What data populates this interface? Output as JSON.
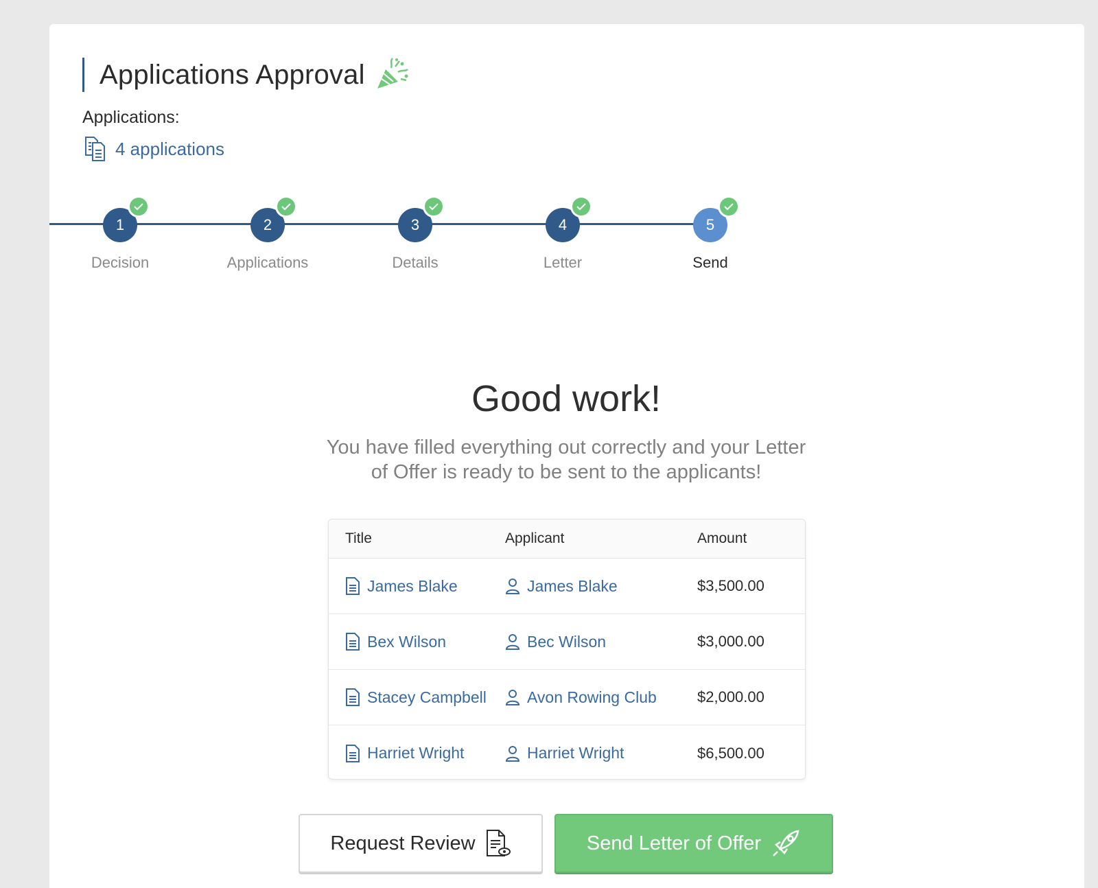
{
  "header": {
    "title": "Applications Approval",
    "icon": "party-popper-icon"
  },
  "applications": {
    "label": "Applications:",
    "link_text": "4 applications"
  },
  "stepper": {
    "steps": [
      {
        "number": "1",
        "label": "Decision",
        "completed": true,
        "active": false
      },
      {
        "number": "2",
        "label": "Applications",
        "completed": true,
        "active": false
      },
      {
        "number": "3",
        "label": "Details",
        "completed": true,
        "active": false
      },
      {
        "number": "4",
        "label": "Letter",
        "completed": true,
        "active": false
      },
      {
        "number": "5",
        "label": "Send",
        "completed": true,
        "active": true
      }
    ]
  },
  "summary": {
    "headline": "Good work!",
    "message": "You have filled everything out correctly and your Letter of Offer is ready to be sent to the applicants!"
  },
  "table": {
    "columns": [
      "Title",
      "Applicant",
      "Amount"
    ],
    "rows": [
      {
        "title": "James Blake",
        "applicant": "James Blake",
        "amount": "$3,500.00"
      },
      {
        "title": "Bex Wilson",
        "applicant": "Bec Wilson",
        "amount": "$3,000.00"
      },
      {
        "title": "Stacey Campbell",
        "applicant": "Avon Rowing Club",
        "amount": "$2,000.00"
      },
      {
        "title": "Harriet Wright",
        "applicant": "Harriet Wright",
        "amount": "$6,500.00"
      }
    ]
  },
  "actions": {
    "review_label": "Request Review",
    "send_label": "Send Letter of Offer"
  },
  "colors": {
    "primary": "#2f5a8a",
    "active_step": "#5b8fd0",
    "success": "#72c97c",
    "link": "#3a6aa0"
  }
}
